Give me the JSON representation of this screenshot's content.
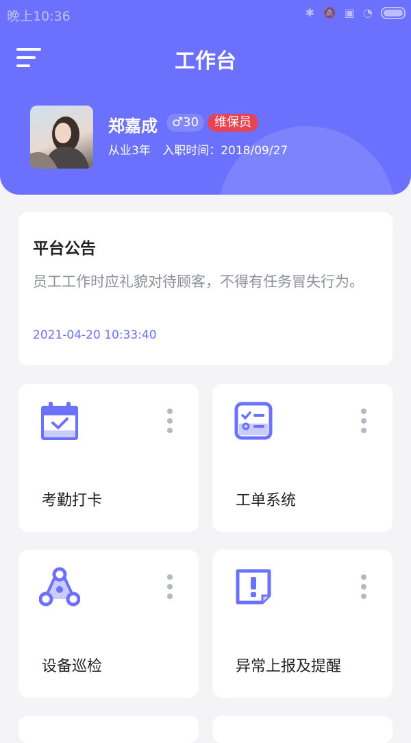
{
  "status_bar": {
    "time": "晚上10:36",
    "icons": [
      "bluetooth-icon",
      "mute-icon",
      "sim-icon",
      "wifi-icon",
      "battery-icon"
    ]
  },
  "header": {
    "title": "工作台",
    "menu_icon": "hamburger-menu-icon",
    "background": "#6c71fd"
  },
  "user": {
    "name": "郑嘉成",
    "gender_age": "♂30",
    "role": "维保员",
    "experience": "从业3年",
    "hire_date": "入职时间：2018/09/27"
  },
  "notice": {
    "title": "平台公告",
    "body": "员工工作时应礼貌对待顾客，不得有任务冒失行为。",
    "time": "2021-04-20 10:33:40"
  },
  "modules": [
    {
      "label": "考勤打卡",
      "icon": "calendar-check-icon"
    },
    {
      "label": "工单系统",
      "icon": "checklist-icon"
    },
    {
      "label": "设备巡检",
      "icon": "nodes-icon"
    },
    {
      "label": "异常上报及提醒",
      "icon": "alert-box-icon"
    }
  ],
  "colors": {
    "accent": "#6c71fd",
    "role_badge": "#e74352",
    "muted_text": "#8a8f9a"
  }
}
